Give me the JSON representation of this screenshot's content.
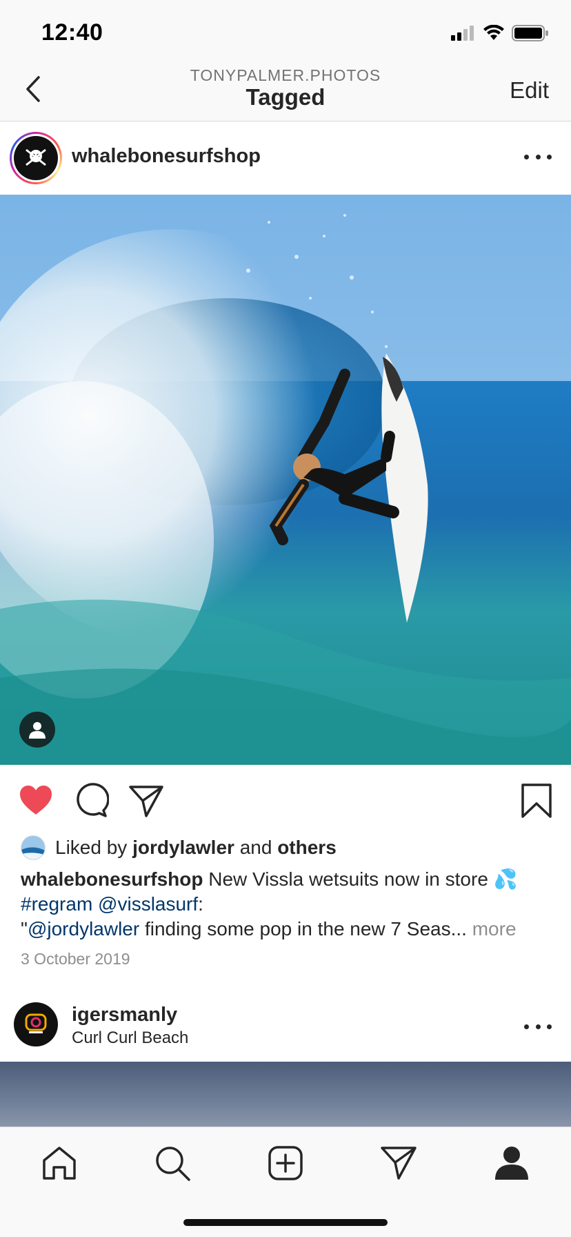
{
  "status_bar": {
    "time": "12:40"
  },
  "nav": {
    "subtitle": "TONYPALMER.PHOTOS",
    "title": "Tagged",
    "edit_label": "Edit"
  },
  "post": {
    "username": "whalebonesurfshop",
    "liked": true,
    "likes": {
      "prefix": "Liked by ",
      "user": "jordylawler",
      "middle": " and ",
      "others": "others"
    },
    "caption": {
      "username": "whalebonesurfshop",
      "text1": " New Vissla wetsuits now in store 💦",
      "hashtag": "#regram",
      "mention1": "@visslasurf",
      "colon": ":",
      "quote_open": "\"",
      "mention2": "@jordylawler",
      "text2": " finding some pop in the new 7 Seas... ",
      "more": "more"
    },
    "date": "3 October 2019"
  },
  "post2": {
    "username": "igersmanly",
    "location": "Curl Curl Beach"
  },
  "colors": {
    "like_red": "#ed4956",
    "link_blue": "#00376b",
    "muted_gray": "#8e8e8e"
  },
  "icons": {
    "nav": [
      "back-chevron-icon"
    ],
    "actions": [
      "heart-icon",
      "comment-icon",
      "share-icon",
      "bookmark-icon"
    ],
    "tabs": [
      "home-icon",
      "search-icon",
      "add-post-icon",
      "direct-icon",
      "profile-icon"
    ]
  }
}
